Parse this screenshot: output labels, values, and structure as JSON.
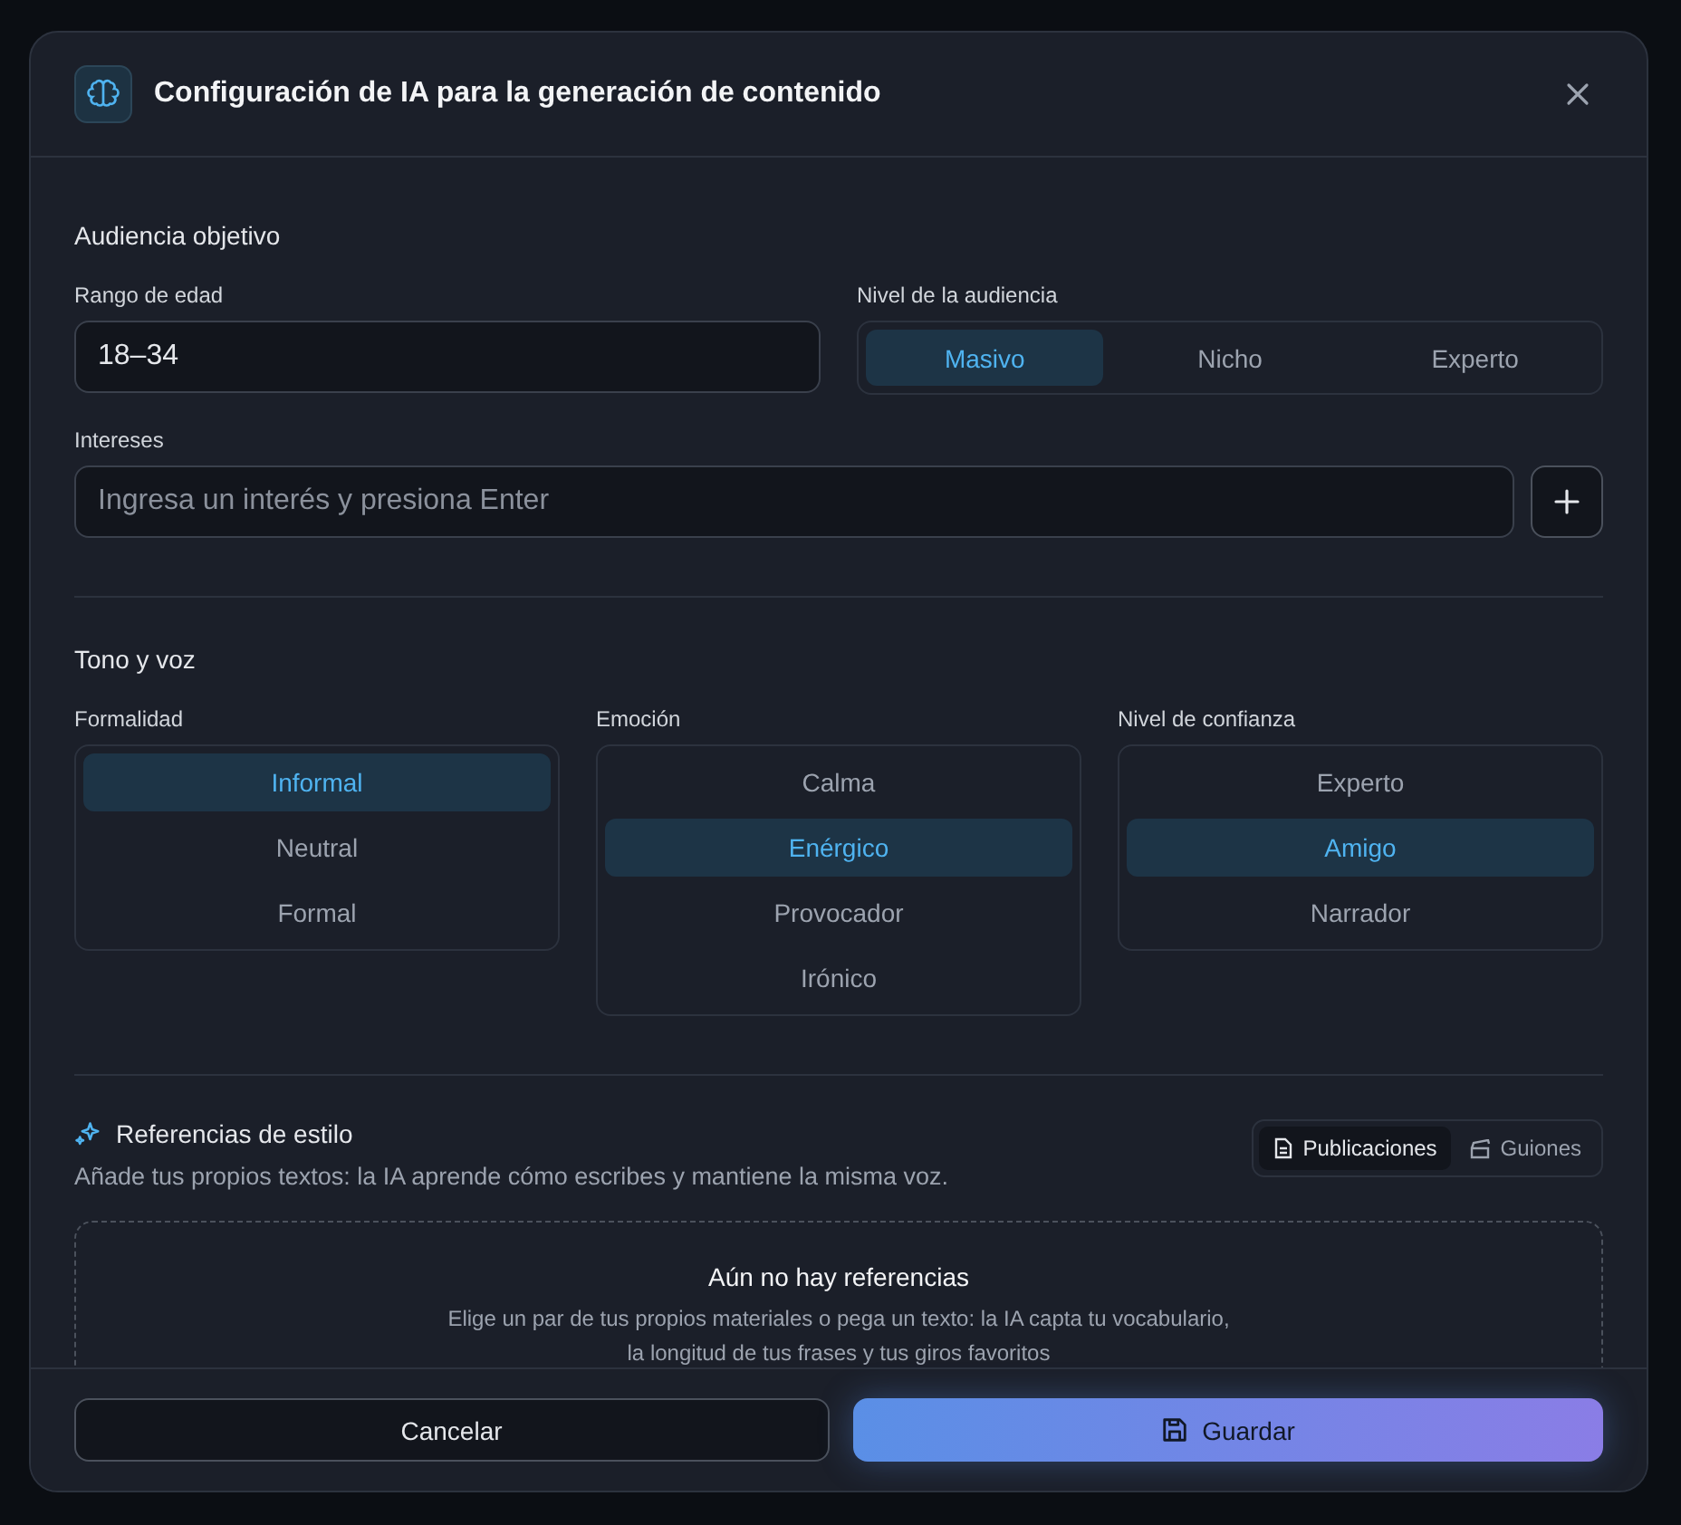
{
  "dialog": {
    "title": "Configuración de IA para la generación de contenido"
  },
  "audience": {
    "heading": "Audiencia objetivo",
    "age_range": {
      "label": "Rango de edad",
      "value": "18–34"
    },
    "level": {
      "label": "Nivel de la audiencia",
      "options": [
        {
          "label": "Masivo",
          "selected": true
        },
        {
          "label": "Nicho",
          "selected": false
        },
        {
          "label": "Experto",
          "selected": false
        }
      ]
    },
    "interests": {
      "label": "Intereses",
      "placeholder": "Ingresa un interés y presiona Enter"
    }
  },
  "tone": {
    "heading": "Tono y voz",
    "groups": [
      {
        "label": "Formalidad",
        "options": [
          {
            "label": "Informal",
            "selected": true
          },
          {
            "label": "Neutral",
            "selected": false
          },
          {
            "label": "Formal",
            "selected": false
          }
        ]
      },
      {
        "label": "Emoción",
        "options": [
          {
            "label": "Calma",
            "selected": false
          },
          {
            "label": "Enérgico",
            "selected": true
          },
          {
            "label": "Provocador",
            "selected": false
          },
          {
            "label": "Irónico",
            "selected": false
          }
        ]
      },
      {
        "label": "Nivel de confianza",
        "options": [
          {
            "label": "Experto",
            "selected": false
          },
          {
            "label": "Amigo",
            "selected": true
          },
          {
            "label": "Narrador",
            "selected": false
          }
        ]
      }
    ]
  },
  "style_refs": {
    "heading": "Referencias de estilo",
    "description": "Añade tus propios textos: la IA aprende cómo escribes y mantiene la misma voz.",
    "tabs": [
      {
        "label": "Publicaciones",
        "selected": true
      },
      {
        "label": "Guiones",
        "selected": false
      }
    ],
    "empty": {
      "title": "Aún no hay referencias",
      "lines": [
        "Elige un par de tus propios materiales o pega un texto: la IA capta tu vocabulario,",
        "la longitud de tus frases y tus giros favoritos"
      ]
    }
  },
  "footer": {
    "cancel": "Cancelar",
    "save": "Guardar"
  }
}
